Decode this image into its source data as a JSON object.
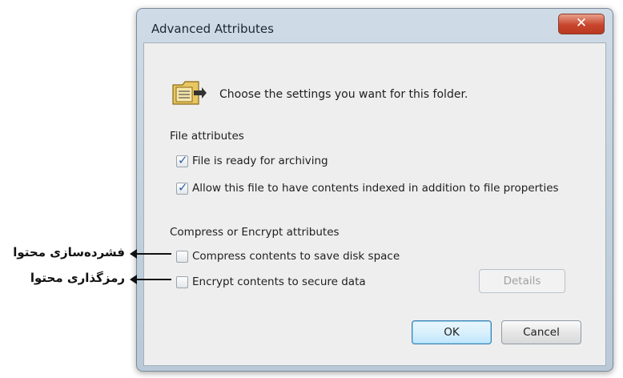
{
  "window": {
    "title": "Advanced Attributes",
    "close_glyph": "✕"
  },
  "dialog": {
    "heading": "Choose the settings you want for this folder.",
    "file_attributes_label": "File attributes",
    "checkboxes": [
      {
        "label": "File is ready for archiving",
        "checked": true
      },
      {
        "label": "Allow this file to have contents indexed in addition to file properties",
        "checked": true
      },
      {
        "label": "Compress contents to save disk space",
        "checked": false
      },
      {
        "label": "Encrypt contents to secure data",
        "checked": false
      }
    ],
    "compress_encrypt_label": "Compress or Encrypt attributes",
    "details_button": "Details",
    "ok_button": "OK",
    "cancel_button": "Cancel"
  },
  "annotations": [
    {
      "text": "فشرده‌سازی محتوا"
    },
    {
      "text": "رمزگذاری محتوا"
    }
  ],
  "icons": {
    "folder": "folder-attributes-icon",
    "close": "close-icon",
    "check": "checkmark-icon"
  },
  "colors": {
    "close_button": "#c8452d",
    "check": "#2f5fa8",
    "client_bg": "#eeeeee"
  }
}
